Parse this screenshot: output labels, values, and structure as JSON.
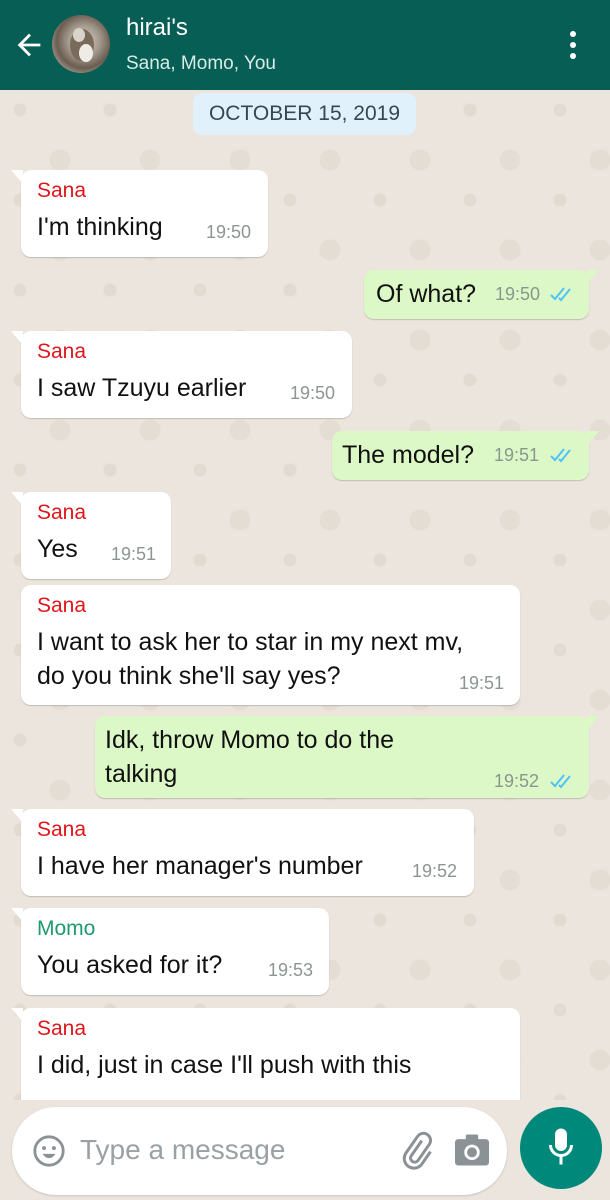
{
  "header": {
    "title": "hirai's",
    "subtitle": "Sana, Momo, You"
  },
  "date_chip": "OCTOBER 15, 2019",
  "messages": [
    {
      "sender": "Sana",
      "text": "I'm thinking",
      "time": "19:50",
      "direction": "in"
    },
    {
      "text": "Of what?",
      "time": "19:50",
      "direction": "out",
      "status": "read"
    },
    {
      "sender": "Sana",
      "text": "I saw Tzuyu earlier",
      "time": "19:50",
      "direction": "in"
    },
    {
      "text": "The model?",
      "time": "19:51",
      "direction": "out",
      "status": "read"
    },
    {
      "sender": "Sana",
      "text": "Yes",
      "time": "19:51",
      "direction": "in"
    },
    {
      "sender": "Sana",
      "text": "I want to ask her to star in my next mv,\ndo you think she'll say yes?",
      "time": "19:51",
      "direction": "in"
    },
    {
      "text": "Idk, throw Momo to do the\ntalking",
      "time": "19:52",
      "direction": "out",
      "status": "read"
    },
    {
      "sender": "Sana",
      "text": "I have her manager's number",
      "time": "19:52",
      "direction": "in"
    },
    {
      "sender": "Momo",
      "text": "You asked for it?",
      "time": "19:53",
      "direction": "in"
    },
    {
      "sender": "Sana",
      "text": "I did, just in case I'll push with this",
      "time": "",
      "direction": "in"
    }
  ],
  "composer": {
    "placeholder": "Type a message"
  },
  "colors": {
    "header": "#075e54",
    "outgoing_bubble": "#dcf8c6",
    "incoming_bubble": "#ffffff",
    "sana_name": "#e0151b",
    "momo_name": "#1f9a6e",
    "read_ticks": "#4fc3f7",
    "mic_button": "#00897b"
  },
  "icons": [
    "back-arrow-icon",
    "group-avatar",
    "more-vert-icon",
    "emoji-icon",
    "attach-icon",
    "camera-icon",
    "mic-icon"
  ]
}
